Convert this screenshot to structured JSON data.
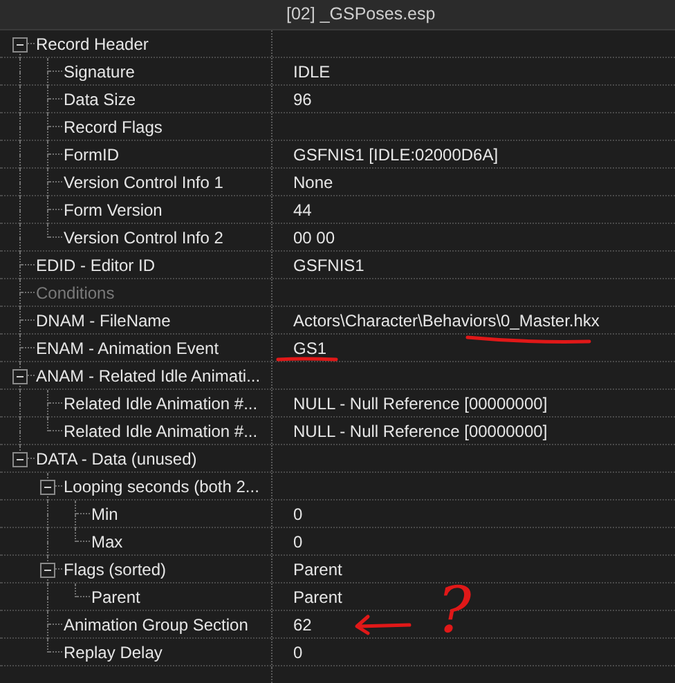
{
  "header": {
    "title": "[02] _GSPoses.esp"
  },
  "rows": [
    {
      "label": "Record Header",
      "expanded": true,
      "children": [
        {
          "label": "Signature",
          "value": "IDLE"
        },
        {
          "label": "Data Size",
          "value": "96"
        },
        {
          "label": "Record Flags"
        },
        {
          "label": "FormID",
          "value": "GSFNIS1 [IDLE:02000D6A]"
        },
        {
          "label": "Version Control Info 1",
          "value": "None"
        },
        {
          "label": "Form Version",
          "value": "44"
        },
        {
          "label": "Version Control Info 2",
          "value": "00 00"
        }
      ]
    },
    {
      "label": "EDID - Editor ID",
      "value": "GSFNIS1"
    },
    {
      "label": "Conditions",
      "disabled": true
    },
    {
      "label": "DNAM - FileName",
      "value": "Actors\\Character\\Behaviors\\0_Master.hkx"
    },
    {
      "label": "ENAM - Animation Event",
      "value": "GS1"
    },
    {
      "label": "ANAM - Related Idle Animati...",
      "expanded": true,
      "children": [
        {
          "label": "Related Idle Animation #...",
          "value": "NULL - Null Reference [00000000]"
        },
        {
          "label": "Related Idle Animation #...",
          "value": "NULL - Null Reference [00000000]"
        }
      ]
    },
    {
      "label": "DATA - Data (unused)",
      "expanded": true,
      "children": [
        {
          "label": "Looping seconds (both 2...",
          "expanded": true,
          "children": [
            {
              "label": "Min",
              "value": "0"
            },
            {
              "label": "Max",
              "value": "0"
            }
          ]
        },
        {
          "label": "Flags (sorted)",
          "value": "Parent",
          "expanded": true,
          "children": [
            {
              "label": "Parent",
              "value": "Parent"
            }
          ]
        },
        {
          "label": "Animation Group Section",
          "value": "62"
        },
        {
          "label": "Replay Delay",
          "value": "0"
        }
      ]
    }
  ],
  "annotations": [
    {
      "kind": "underline-path"
    },
    {
      "kind": "underline-event"
    },
    {
      "kind": "arrow"
    },
    {
      "kind": "question",
      "mark": "?"
    }
  ]
}
